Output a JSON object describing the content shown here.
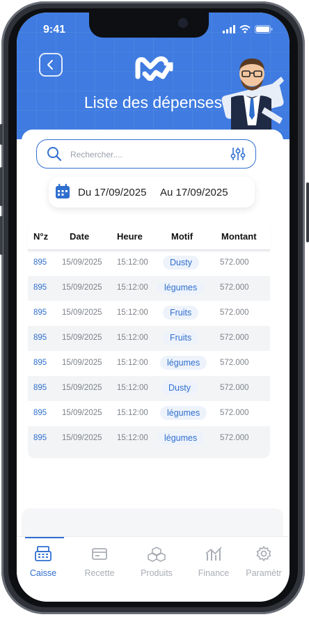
{
  "status_bar": {
    "time": "9:41"
  },
  "header": {
    "title": "Liste des dépenses"
  },
  "search": {
    "placeholder": "Rechercher...."
  },
  "date_range": {
    "from": "Du 17/09/2025",
    "to": "Au 17/09/2025"
  },
  "table": {
    "columns": [
      "N°z",
      "Date",
      "Heure",
      "Motif",
      "Montant"
    ],
    "rows": [
      {
        "nz": "895",
        "date": "15/09/2025",
        "heure": "15:12:00",
        "motif": "Dusty",
        "montant": "572.000"
      },
      {
        "nz": "895",
        "date": "15/09/2025",
        "heure": "15:12:00",
        "motif": "légumes",
        "montant": "572.000"
      },
      {
        "nz": "895",
        "date": "15/09/2025",
        "heure": "15:12:00",
        "motif": "Fruits",
        "montant": "572.000"
      },
      {
        "nz": "895",
        "date": "15/09/2025",
        "heure": "15:12:00",
        "motif": "Fruits",
        "montant": "572.000"
      },
      {
        "nz": "895",
        "date": "15/09/2025",
        "heure": "15:12:00",
        "motif": "légumes",
        "montant": "572.000"
      },
      {
        "nz": "895",
        "date": "15/09/2025",
        "heure": "15:12:00",
        "motif": "Dusty",
        "montant": "572.000"
      },
      {
        "nz": "895",
        "date": "15/09/2025",
        "heure": "15:12:00",
        "motif": "légumes",
        "montant": "572.000"
      },
      {
        "nz": "895",
        "date": "15/09/2025",
        "heure": "15:12:00",
        "motif": "légumes",
        "montant": "572.000"
      }
    ]
  },
  "tabbar": {
    "tabs": [
      {
        "label": "Caisse",
        "icon": "cash-register-icon",
        "active": true
      },
      {
        "label": "Recette",
        "icon": "card-icon",
        "active": false
      },
      {
        "label": "Produits",
        "icon": "boxes-icon",
        "active": false
      },
      {
        "label": "Finance",
        "icon": "chart-icon",
        "active": false
      },
      {
        "label": "Paramètr",
        "icon": "gear-icon",
        "active": false
      }
    ]
  },
  "colors": {
    "primary": "#3f7be0",
    "accent": "#2f6fce"
  }
}
